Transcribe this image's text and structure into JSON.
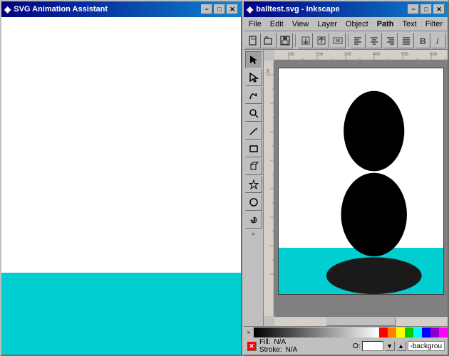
{
  "left_window": {
    "title": "SVG Animation Assistant",
    "title_icon": "◆",
    "btn_minimize": "−",
    "btn_maximize": "□",
    "btn_close": "✕",
    "cyan_bar_color": "#00CED1"
  },
  "right_window": {
    "title": "balltest.svg - Inkscape",
    "title_icon": "◈",
    "btn_minimize": "−",
    "btn_maximize": "□",
    "btn_close": "✕"
  },
  "menu": {
    "items": [
      "File",
      "Edit",
      "View",
      "Layer",
      "Object",
      "Path",
      "Text",
      "Filter"
    ]
  },
  "toolbar": {
    "buttons": [
      "□",
      "□",
      "□",
      "↙",
      "↙",
      "⊟",
      "≡",
      "≡",
      "≡",
      "≡",
      "≡",
      "≡",
      "≡"
    ]
  },
  "tools": {
    "items": [
      "↖",
      "↖",
      "~",
      "🔍",
      "✏",
      "□",
      "◈",
      "⬡",
      "○",
      "✦",
      "🌀"
    ]
  },
  "status": {
    "fill_label": "Fill:",
    "fill_value": "N/A",
    "stroke_label": "Stroke:",
    "stroke_value": "N/A",
    "opacity_label": "O:",
    "opacity_value": "",
    "bg_label": "-backgrou"
  },
  "colors": {
    "gradient": [
      "#000000",
      "#1a1a1a",
      "#333333",
      "#4d4d4d",
      "#666666",
      "#808080",
      "#999999",
      "#b3b3b3",
      "#cccccc",
      "#e6e6e6",
      "#ffffff"
    ],
    "swatches": [
      "#ff0000",
      "#ff8000",
      "#ffff00",
      "#00ff00",
      "#00ffff",
      "#0000ff",
      "#8000ff",
      "#ff00ff",
      "#ff0080"
    ]
  }
}
